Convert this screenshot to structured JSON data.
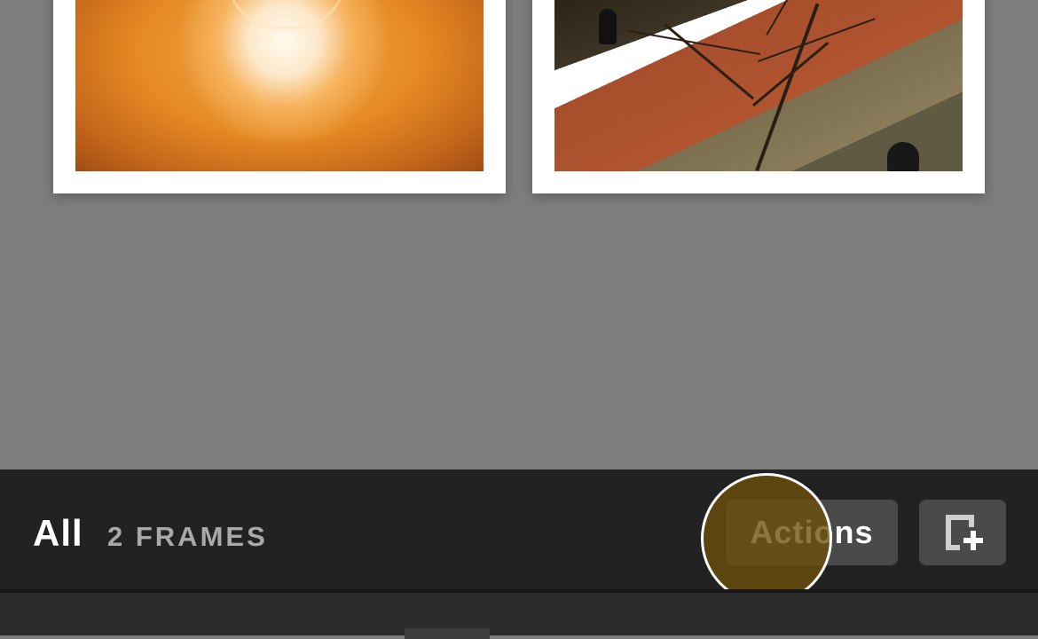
{
  "frames": [
    {
      "name": "bulb-photo"
    },
    {
      "name": "street-photo"
    }
  ],
  "footer": {
    "filter_label": "All",
    "frames_count": "2 FRAMES",
    "actions_label": "Actions"
  },
  "icons": {
    "add_frame": "add-frame-icon"
  },
  "colors": {
    "bar_background": "#222222",
    "button_background": "#4a4a4a",
    "touch_indicator": "#6e500a"
  }
}
